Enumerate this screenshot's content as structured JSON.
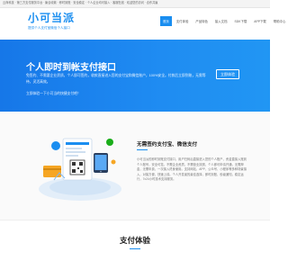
{
  "topbar": {
    "text": "云商科技 · 第三方支付服务平台 · 聚合收款 · 即时到账 · 安全稳定 · 个人企业均可接入 · 客服在线 · 欢迎您的访问 · 合作共赢"
  },
  "logo": {
    "text": "小可当派",
    "slogan": "提供个人支付宝微信个人接口"
  },
  "nav": {
    "items": [
      {
        "label": "首页",
        "active": true
      },
      {
        "label": "支付体验",
        "active": false
      },
      {
        "label": "产品特色",
        "active": false
      },
      {
        "label": "接入文档",
        "active": false
      },
      {
        "label": "SDK下载",
        "active": false
      },
      {
        "label": "APP下载",
        "active": false
      },
      {
        "label": "帮助中心",
        "active": false
      }
    ]
  },
  "hero": {
    "title": "个人即时到帐支付接口",
    "desc": "免签约、不需要企业资质，个人即可签约，收款直接进入您的支付宝和微信账户，100%安全。付款后立即到账，无需等待，灵活高效。",
    "sub": "立即体验一下小可当的快捷支付吧！",
    "button": "立即体验"
  },
  "section": {
    "title": "无需签约支付宝、微信支付",
    "body": "小可当派的即时到账支付接口，用户扫码后直接进入您的个人账户，资金直接入账到个人账号，安全可靠。不需企业资质，不需营业执照，个人即可申请开通，无需押金，无需年费，一次接入终身使用。支持网站、APP、公众号、小程序等多种场景接入，对接方便，快速上线。个人开发者的最佳选择，即时到账，秒级通知，稳定运行，7x24小时技术支持服务。"
  },
  "section2": {
    "title": "支付体验"
  }
}
